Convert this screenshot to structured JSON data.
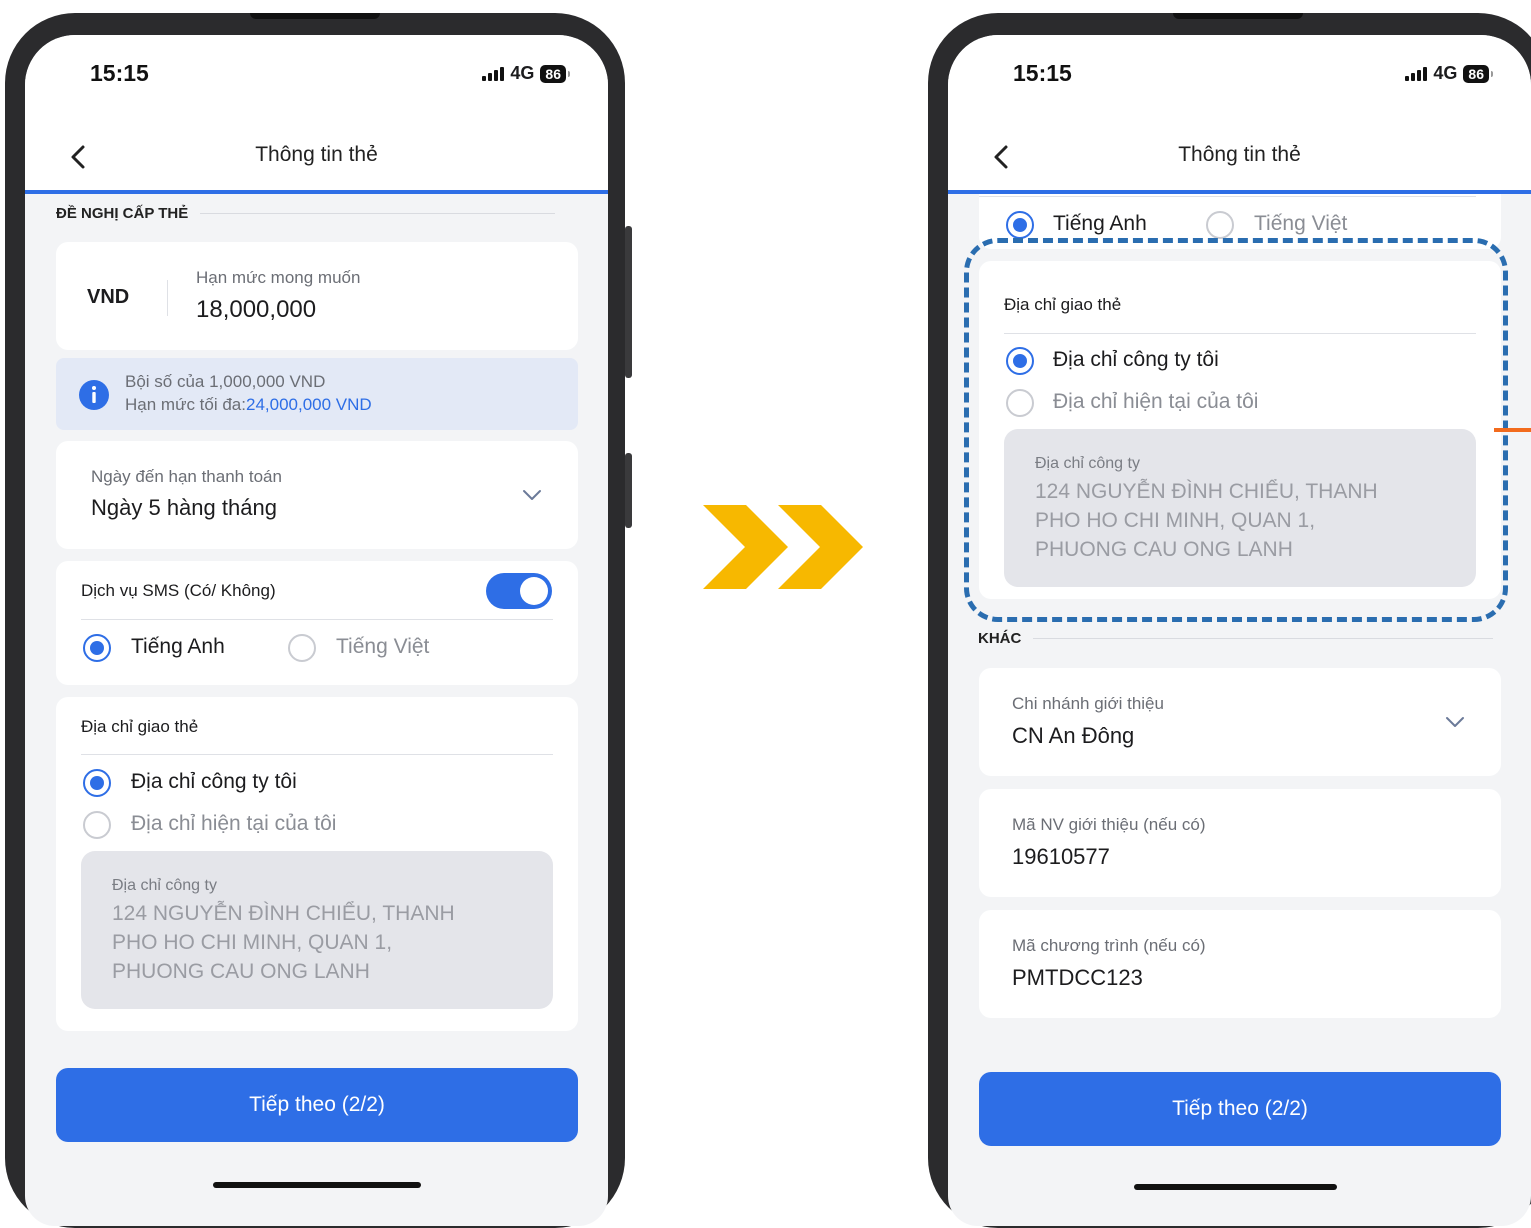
{
  "transition_arrow_color": "#f7b800",
  "highlight_color": "#2a6db0",
  "accent_color": "#2e6ee6",
  "left_screen": {
    "status": {
      "time": "15:15",
      "network": "4G",
      "battery": "86"
    },
    "header": {
      "title": "Thông tin thẻ"
    },
    "section_title": "ĐỀ NGHỊ CẤP THẺ",
    "limit": {
      "currency": "VND",
      "label": "Hạn mức mong muốn",
      "value": "18,000,000"
    },
    "info": {
      "line1": "Bội số của 1,000,000 VND",
      "line2_prefix": "Hạn mức tối đa:",
      "line2_value": "24,000,000 VND"
    },
    "due_date": {
      "label": "Ngày đến hạn thanh toán",
      "value": "Ngày 5 hàng tháng"
    },
    "sms": {
      "label": "Dịch vụ SMS (Có/ Không)",
      "enabled": true,
      "option_en": "Tiếng Anh",
      "option_vi": "Tiếng Việt",
      "selected": "Tiếng Anh"
    },
    "delivery": {
      "label": "Địa chỉ giao thẻ",
      "option_company": "Địa chỉ công ty tôi",
      "option_current": "Địa chỉ hiện tại của tôi",
      "selected": "Địa chỉ công ty tôi",
      "address_label": "Địa chỉ công ty",
      "address_value": "124 NGUYỄN ĐÌNH CHIỂU, THANH\nPHO HO CHI MINH, QUAN 1,\nPHUONG CAU ONG LANH"
    },
    "next_button": "Tiếp theo (2/2)"
  },
  "right_screen": {
    "status": {
      "time": "15:15",
      "network": "4G",
      "battery": "86"
    },
    "header": {
      "title": "Thông tin thẻ"
    },
    "sms": {
      "option_en": "Tiếng Anh",
      "option_vi": "Tiếng Việt",
      "selected": "Tiếng Anh"
    },
    "delivery": {
      "label": "Địa chỉ giao thẻ",
      "option_company": "Địa chỉ công ty tôi",
      "option_current": "Địa chỉ hiện tại của tôi",
      "selected": "Địa chỉ công ty tôi",
      "address_label": "Địa chỉ công ty",
      "address_value": "124 NGUYỄN ĐÌNH CHIỂU, THANH\nPHO HO CHI MINH, QUAN 1,\nPHUONG CAU ONG LANH"
    },
    "other_section_title": "KHÁC",
    "branch": {
      "label": "Chi nhánh giới thiệu",
      "value": "CN An Đông"
    },
    "staff_code": {
      "label": "Mã NV giới thiệu (nếu có)",
      "value": "19610577"
    },
    "program_code": {
      "label": "Mã chương trình (nếu có)",
      "value": "PMTDCC123"
    },
    "next_button": "Tiếp theo (2/2)"
  }
}
